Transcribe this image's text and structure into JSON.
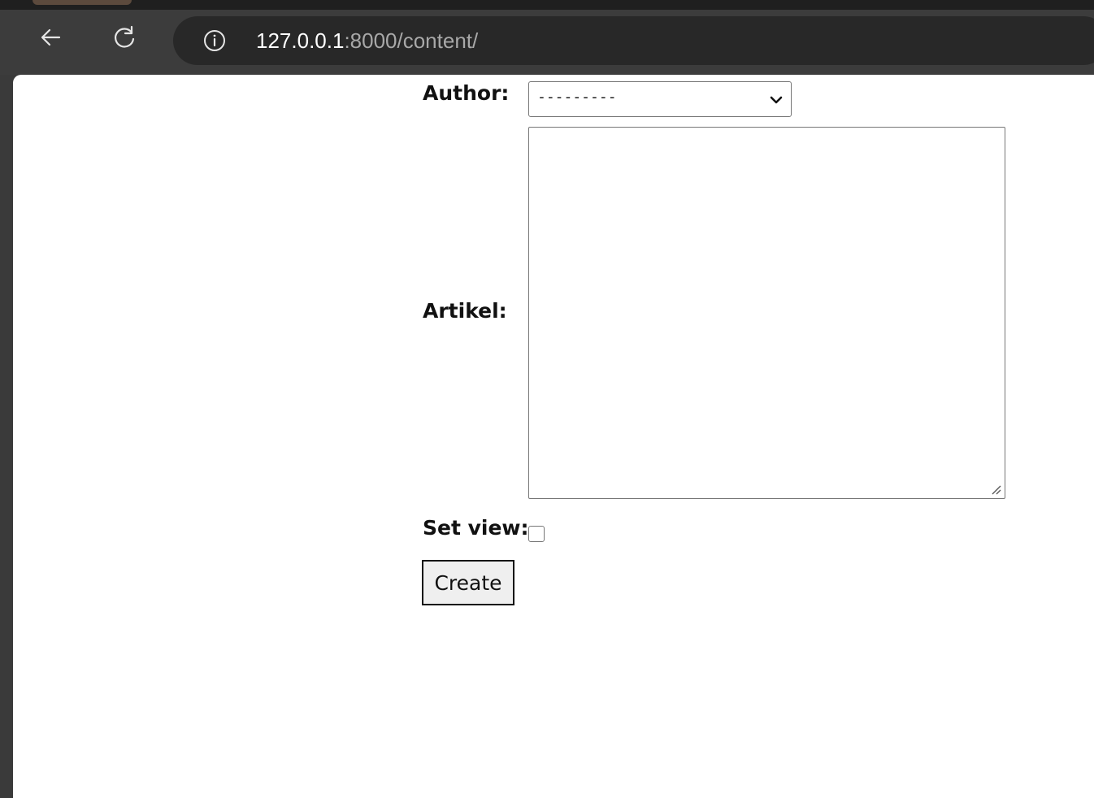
{
  "browser": {
    "url_host": "127.0.0.1",
    "url_rest": ":8000/content/",
    "icons": {
      "back": "arrow-left-icon",
      "reload": "reload-icon",
      "site_info": "info-icon"
    }
  },
  "form": {
    "author_label": "Author:",
    "author_value": "---------",
    "artikel_label": "Artikel:",
    "artikel_value": "",
    "set_view_label": "Set view:",
    "set_view_checked": false,
    "create_label": "Create"
  },
  "colors": {
    "toolbar": "#3c3c3c",
    "omnibox": "#282828",
    "page_background": "#ffffff"
  }
}
